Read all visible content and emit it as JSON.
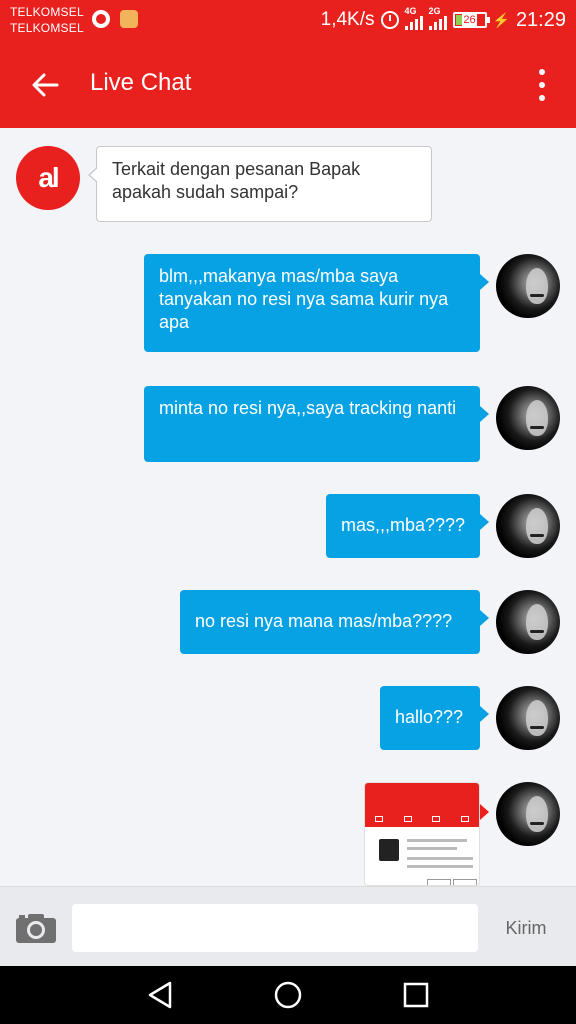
{
  "status_bar": {
    "carriers": [
      "TELKOMSEL",
      "TELKOMSEL"
    ],
    "network_speed": "1,4K/s",
    "signal1_tag": "4G",
    "signal2_tag": "2G",
    "battery_level": "26",
    "time": "21:29"
  },
  "app_bar": {
    "title": "Live Chat",
    "back_icon": "arrow-left-icon",
    "menu_icon": "more-vertical-icon"
  },
  "agent": {
    "avatar_text": "al",
    "brand_color": "#e8211e"
  },
  "messages": [
    {
      "from": "agent",
      "text": "Terkait dengan pesanan Bapak apakah sudah sampai?"
    },
    {
      "from": "user",
      "text": "blm,,,makanya mas/mba saya tanyakan no resi nya sama kurir nya apa"
    },
    {
      "from": "user",
      "text": "minta no resi nya,,saya tracking nanti"
    },
    {
      "from": "user",
      "text": "mas,,,mba????"
    },
    {
      "from": "user",
      "text": "no resi nya mana mas/mba????"
    },
    {
      "from": "user",
      "text": "hallo???"
    },
    {
      "from": "user",
      "type": "image",
      "text": ""
    }
  ],
  "input_bar": {
    "camera_icon": "camera-icon",
    "placeholder": "",
    "send_label": "Kirim"
  },
  "colors": {
    "primary": "#e8211e",
    "outgoing_bubble": "#07a2e4"
  }
}
